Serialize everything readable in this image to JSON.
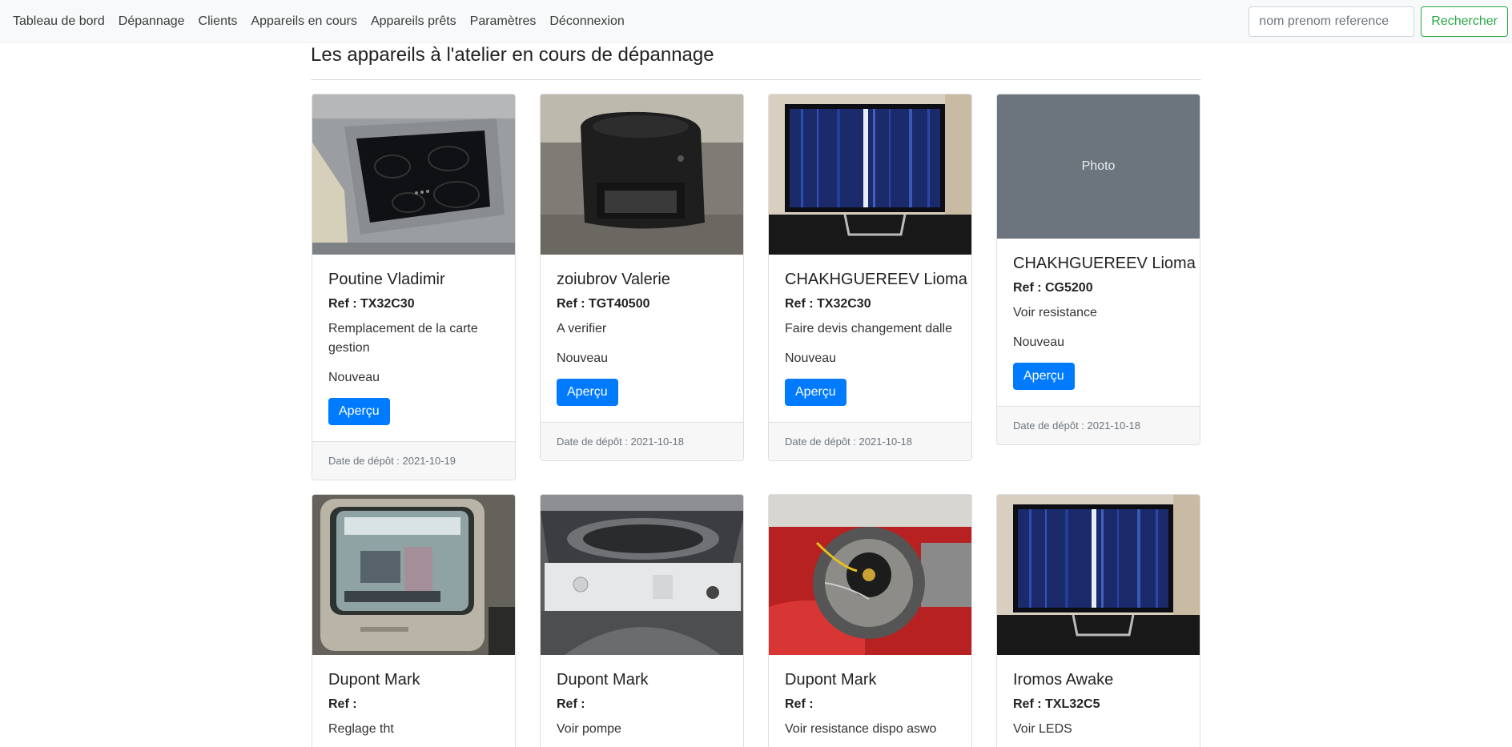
{
  "nav": {
    "items": [
      "Tableau de bord",
      "Dépannage",
      "Clients",
      "Appareils en cours",
      "Appareils prêts",
      "Paramètres",
      "Déconnexion"
    ],
    "search_placeholder": "nom prenom reference",
    "search_button": "Rechercher"
  },
  "page": {
    "title": "Les appareils à l'atelier en cours de dépannage"
  },
  "cards": [
    {
      "image": "induction-cooktop-photo",
      "name": "Poutine Vladimir",
      "ref": "Ref : TX32C30",
      "desc": "Remplacement de la carte gestion",
      "status": "Nouveau",
      "button": "Aperçu",
      "footer": "Date de dépôt : 2021-10-19"
    },
    {
      "image": "coffee-machine-photo",
      "name": "zoiubrov Valerie",
      "ref": "Ref : TGT40500",
      "desc": "A verifier",
      "status": "Nouveau",
      "button": "Aperçu",
      "footer": "Date de dépôt : 2021-10-18"
    },
    {
      "image": "tv-screen-lines-photo",
      "name": "CHAKHGUEREEV Lioma",
      "ref": "Ref : TX32C30",
      "desc": "Faire devis changement dalle",
      "status": "Nouveau",
      "button": "Aperçu",
      "footer": "Date de dépôt : 2021-10-18"
    },
    {
      "image": "photo-placeholder",
      "placeholder": "Photo",
      "name": "CHAKHGUEREEV Lioma",
      "ref": "Ref : CG5200",
      "desc": "Voir resistance",
      "status": "Nouveau",
      "button": "Aperçu",
      "footer": "Date de dépôt : 2021-10-18"
    },
    {
      "image": "crt-tv-photo",
      "name": "Dupont Mark",
      "ref": "Ref :",
      "desc": "Reglage tht"
    },
    {
      "image": "washing-machine-photo",
      "name": "Dupont Mark",
      "ref": "Ref :",
      "desc": "Voir pompe"
    },
    {
      "image": "motor-part-photo",
      "name": "Dupont Mark",
      "ref": "Ref :",
      "desc": "Voir resistance dispo aswo"
    },
    {
      "image": "tv-screen-lines-photo",
      "name": "Iromos Awake",
      "ref": "Ref : TXL32C5",
      "desc": "Voir LEDS"
    }
  ],
  "colors": {
    "primary": "#007bff",
    "success": "#28a745",
    "placeholder_bg": "#6c757d"
  }
}
